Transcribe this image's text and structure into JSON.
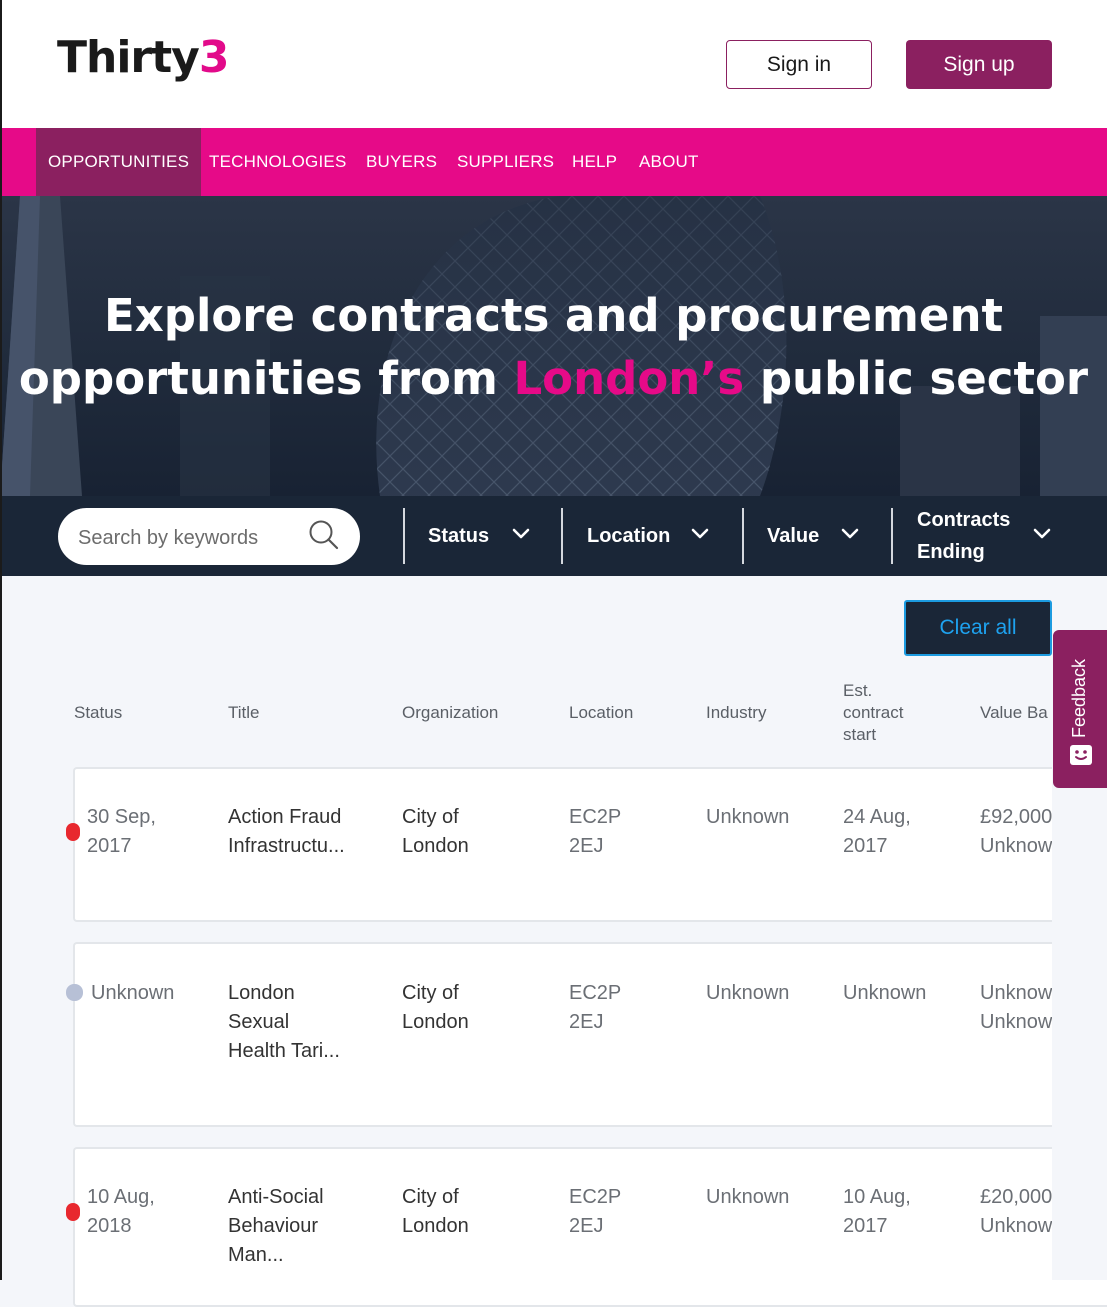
{
  "header": {
    "logo_main": "Thirty",
    "logo_accent": "3",
    "signin_label": "Sign in",
    "signup_label": "Sign up"
  },
  "nav": {
    "items": [
      "OPPORTUNITIES",
      "TECHNOLOGIES",
      "BUYERS",
      "SUPPLIERS",
      "HELP",
      "ABOUT"
    ],
    "active": "OPPORTUNITIES"
  },
  "hero": {
    "line1": "Explore contracts and procurement",
    "line2_start": "opportunities from ",
    "line2_highlight": "London’s",
    "line2_end": " public sector"
  },
  "filters": {
    "search_placeholder": "Search by keywords",
    "status": "Status",
    "location": "Location",
    "value": "Value",
    "contracts_ending_1": "Contracts",
    "contracts_ending_2": "Ending"
  },
  "clear_all": "Clear all",
  "table": {
    "headers": {
      "status": "Status",
      "title": "Title",
      "organization": "Organization",
      "location": "Location",
      "industry": "Industry",
      "est_1": "Est.",
      "est_2": "contract",
      "est_3": "start",
      "value": "Value Ba"
    },
    "rows": [
      {
        "status_color": "#e8282e",
        "status_1": "30 Sep,",
        "status_2": "2017",
        "title_1": "Action Fraud",
        "title_2": "Infrastructu...",
        "title_3": "",
        "org_1": "City of",
        "org_2": "London",
        "loc_1": "EC2P",
        "loc_2": "2EJ",
        "industry": "Unknown",
        "start_1": "24 Aug,",
        "start_2": "2017",
        "value_1": "£92,000",
        "value_2": "Unknown"
      },
      {
        "status_color": "#b7c0d6",
        "status_1": "Unknown",
        "status_2": "",
        "title_1": "London",
        "title_2": "Sexual",
        "title_3": "Health Tari...",
        "org_1": "City of",
        "org_2": "London",
        "loc_1": "EC2P",
        "loc_2": "2EJ",
        "industry": "Unknown",
        "start_1": "Unknown",
        "start_2": "",
        "value_1": "Unknown",
        "value_2": "Unknown"
      },
      {
        "status_color": "#e8282e",
        "status_1": "10 Aug,",
        "status_2": "2018",
        "title_1": "Anti-Social",
        "title_2": "Behaviour",
        "title_3": "Man...",
        "org_1": "City of",
        "org_2": "London",
        "loc_1": "EC2P",
        "loc_2": "2EJ",
        "industry": "Unknown",
        "start_1": "10 Aug,",
        "start_2": "2017",
        "value_1": "£20,000",
        "value_2": "Unknown"
      }
    ]
  },
  "feedback_label": "Feedback",
  "colors": {
    "brand_pink": "#e60a88",
    "brand_plum": "#8b2060",
    "navy": "#1a2637",
    "link_blue": "#1ea2ef"
  }
}
